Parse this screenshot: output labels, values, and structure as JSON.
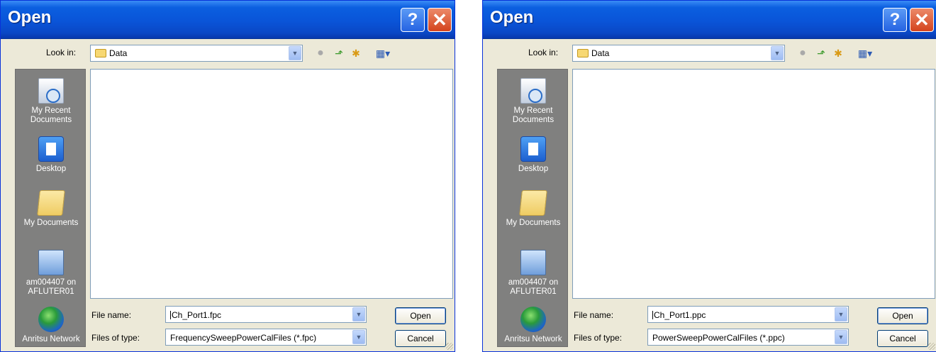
{
  "dialogs": [
    {
      "title": "Open",
      "title_icons": {
        "help": "?",
        "close": "✕"
      },
      "look_in_label": "Look in:",
      "look_in_value": "Data",
      "toolbar_icons": [
        "back-icon",
        "up-folder-icon",
        "new-folder-icon",
        "views-menu-icon"
      ],
      "places": [
        "My Recent Documents",
        "Desktop",
        "My Documents",
        "am004407 on AFLUTER01",
        "Anritsu Network"
      ],
      "file_name_label": "File name:",
      "file_name_value": "Ch_Port1.fpc",
      "files_of_type_label": "Files of type:",
      "files_of_type_value": "FrequencySweepPowerCalFiles (*.fpc)",
      "open_button": "Open",
      "cancel_button": "Cancel"
    },
    {
      "title": "Open",
      "title_icons": {
        "help": "?",
        "close": "✕"
      },
      "look_in_label": "Look in:",
      "look_in_value": "Data",
      "toolbar_icons": [
        "back-icon",
        "up-folder-icon",
        "new-folder-icon",
        "views-menu-icon"
      ],
      "places": [
        "My Recent Documents",
        "Desktop",
        "My Documents",
        "am004407 on AFLUTER01",
        "Anritsu Network"
      ],
      "file_name_label": "File name:",
      "file_name_value": "Ch_Port1.ppc",
      "files_of_type_label": "Files of type:",
      "files_of_type_value": "PowerSweepPowerCalFiles (*.ppc)",
      "open_button": "Open",
      "cancel_button": "Cancel"
    }
  ],
  "colors": {
    "titlebar": "#0a54d8",
    "dialog_bg": "#ece9d8",
    "places_bar": "#80807f",
    "close_button": "#d4431d"
  }
}
